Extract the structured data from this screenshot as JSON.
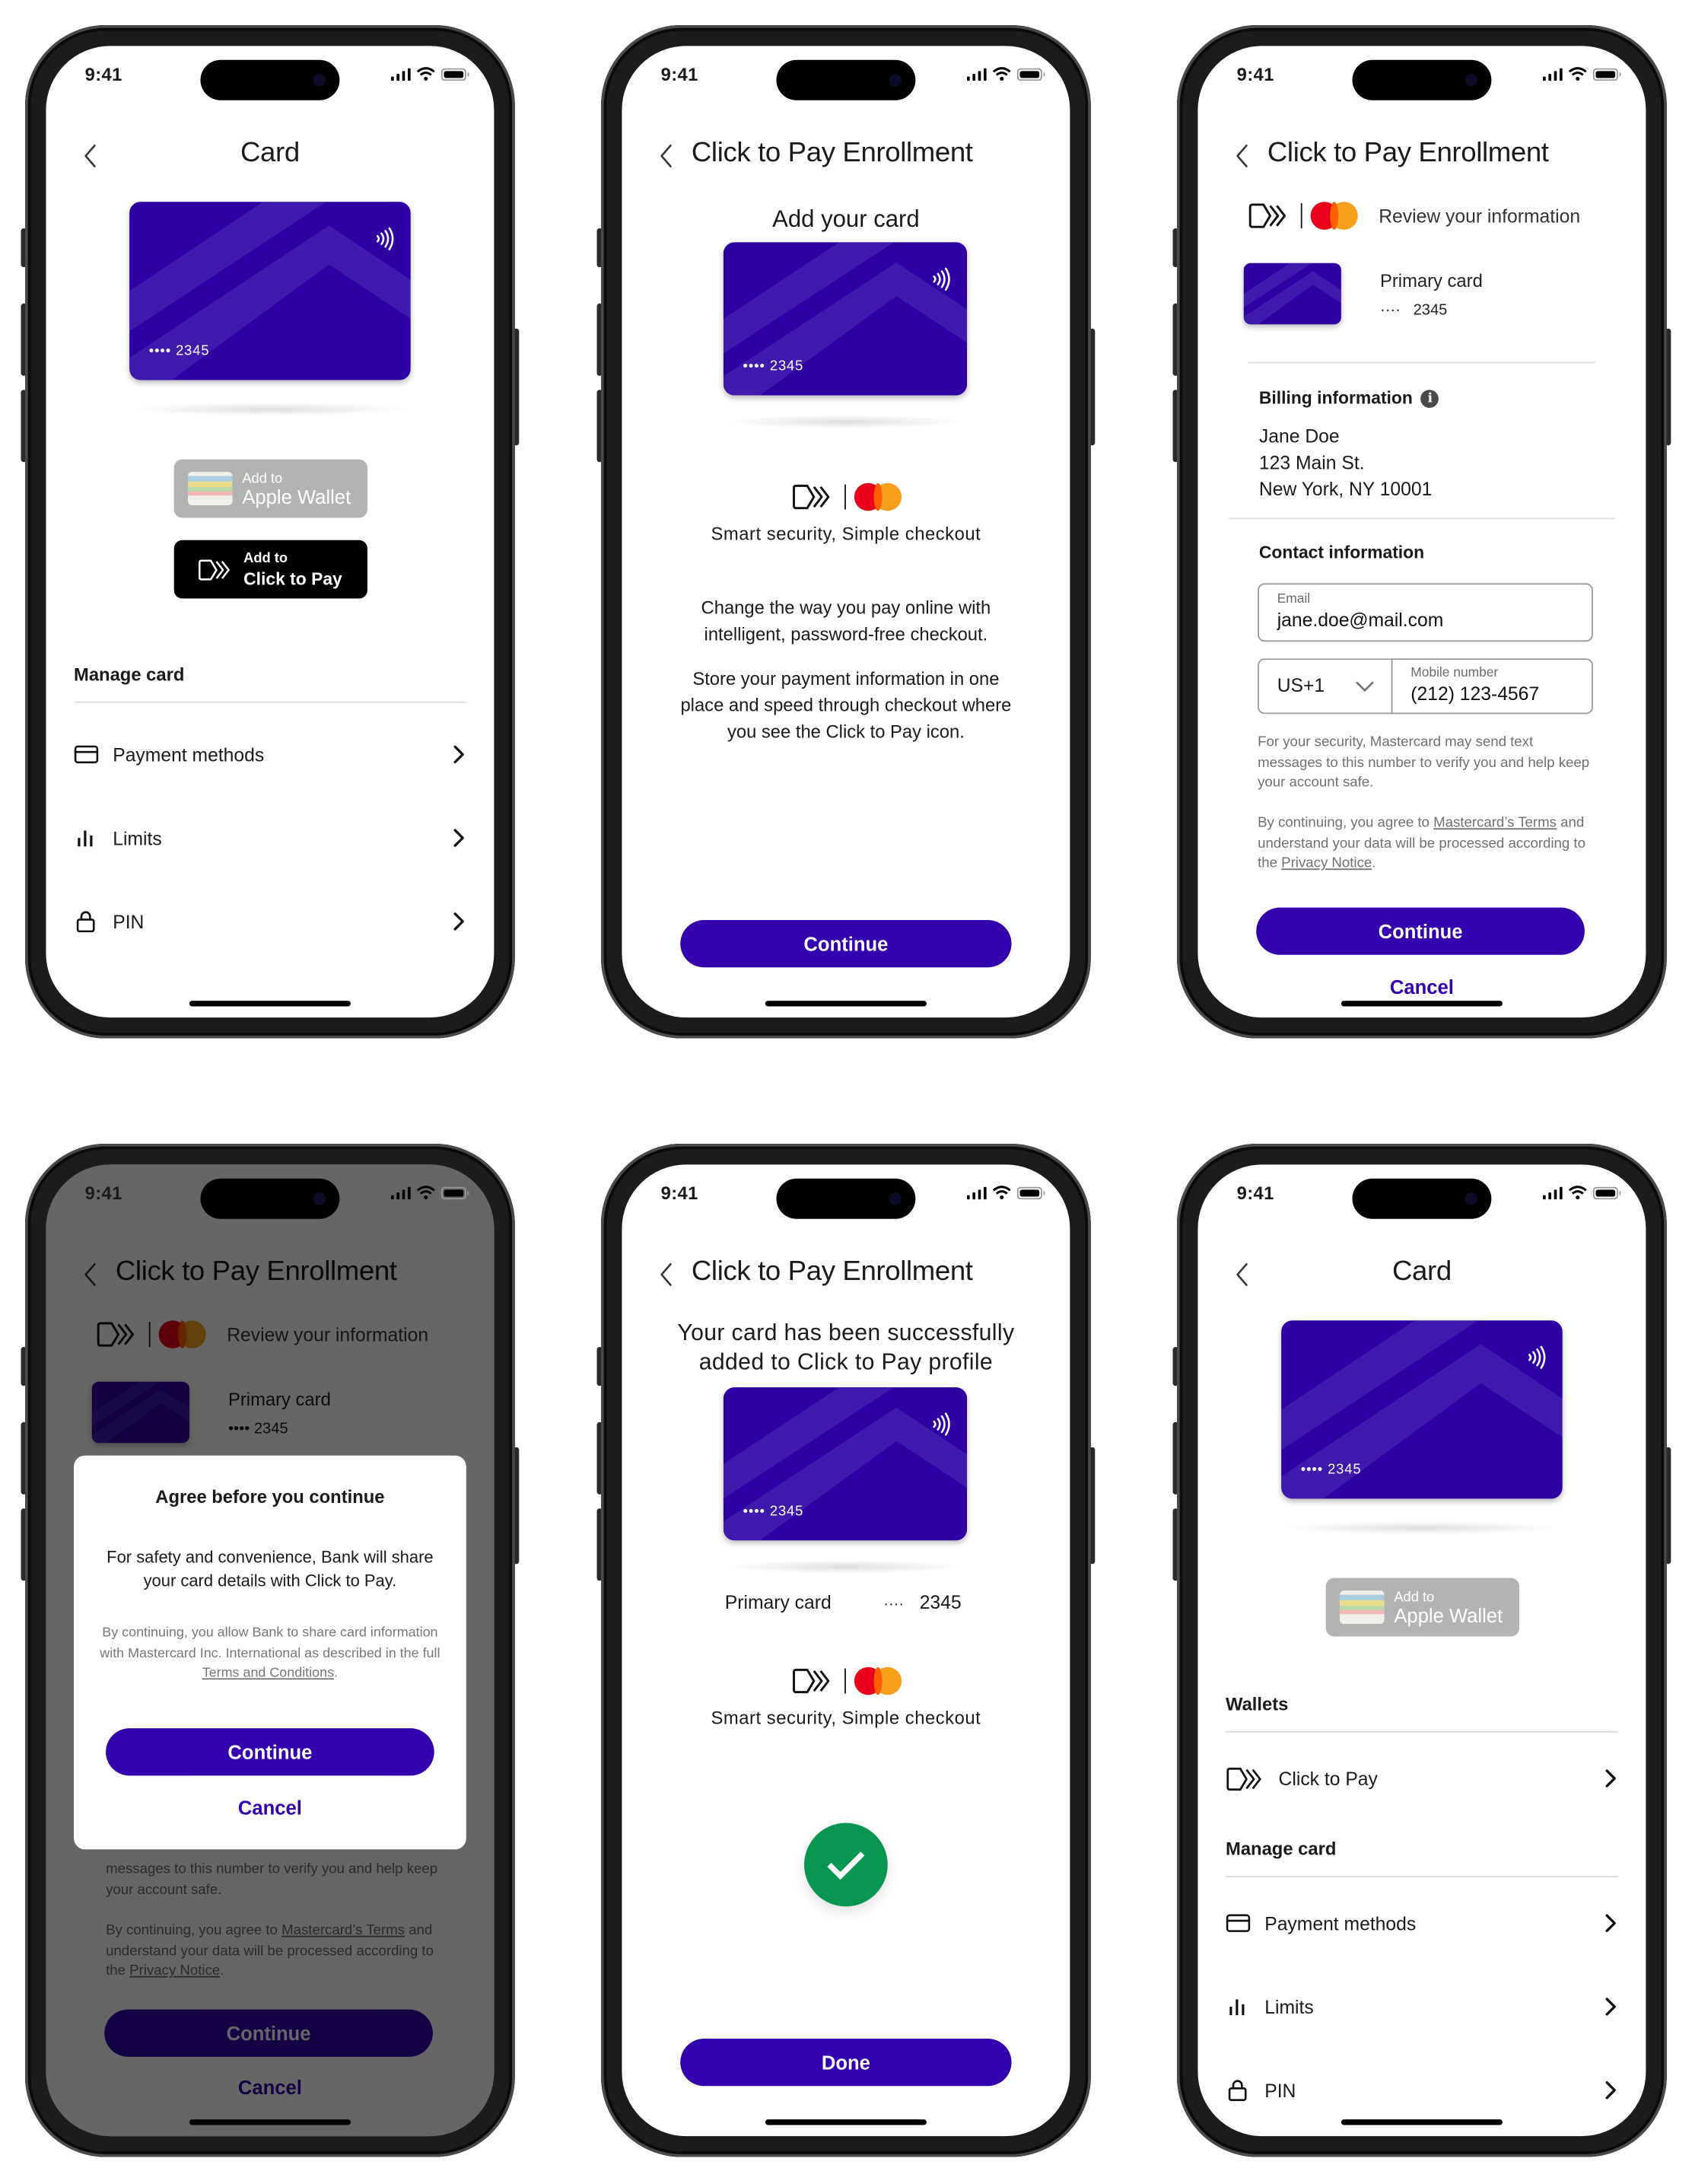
{
  "status_bar": {
    "time": "9:41"
  },
  "brand": {
    "accent": "#3300ad",
    "card_base": "#2e00a3",
    "card_stripe": "#3f1aad",
    "success_green": "#079650",
    "mc_red": "#eb001b",
    "mc_orange": "#f79e1b"
  },
  "card": {
    "masked_dots": "••••",
    "last4": "2345",
    "dots_plain": "····"
  },
  "screen1": {
    "title": "Card",
    "wallet_button": {
      "line1": "Add to",
      "line2": "Apple Wallet"
    },
    "ctp_button": {
      "line1": "Add to",
      "line2": "Click to Pay"
    },
    "manage_header": "Manage card",
    "items": [
      {
        "icon": "credit-card-icon",
        "label": "Payment methods"
      },
      {
        "icon": "bar-chart-icon",
        "label": "Limits"
      },
      {
        "icon": "lock-icon",
        "label": "PIN"
      }
    ]
  },
  "screen2": {
    "title": "Click to Pay Enrollment",
    "subtitle": "Add your card",
    "tagline": "Smart security, Simple checkout",
    "para1": "Change the way you pay online with intelligent, password-free checkout.",
    "para2": "Store your payment information in one place and speed through checkout where you see the Click to Pay icon.",
    "continue": "Continue"
  },
  "screen3": {
    "title": "Click to Pay Enrollment",
    "review": "Review your information",
    "card_label": "Primary card",
    "billing_header": "Billing information",
    "billing_lines": [
      "Jane Doe",
      "123 Main St.",
      "New York, NY 10001"
    ],
    "contact_header": "Contact information",
    "email_label": "Email",
    "email_value": "jane.doe@mail.com",
    "country_code": "US+1",
    "mobile_label": "Mobile number",
    "mobile_value": "(212) 123-4567",
    "security_note": "For your security, Mastercard may send text messages to this number to verify you and help keep your account safe.",
    "terms_prefix": "By continuing, you agree to ",
    "terms_link": "Mastercard’s Terms",
    "terms_mid": " and understand your data will be processed according to the ",
    "privacy_link": "Privacy Notice",
    "terms_suffix": ".",
    "continue": "Continue",
    "cancel": "Cancel"
  },
  "screen4": {
    "modal_title": "Agree before you continue",
    "modal_body": "For safety and convenience, Bank will share your card details with Click to Pay.",
    "modal_fine_prefix": "By continuing, you allow Bank to share card information with Mastercard Inc. International as described in the full ",
    "modal_fine_link": "Terms and Conditions",
    "modal_fine_suffix": ".",
    "continue": "Continue",
    "cancel": "Cancel",
    "bg_security_tail": "messages to this number to verify you and help keep your account safe."
  },
  "screen5": {
    "title": "Click to Pay Enrollment",
    "headline": "Your card has been successfully added to Click to Pay profile",
    "card_label": "Primary card",
    "tagline": "Smart security, Simple checkout",
    "done": "Done"
  },
  "screen6": {
    "title": "Card",
    "wallet_button": {
      "line1": "Add to",
      "line2": "Apple Wallet"
    },
    "wallets_header": "Wallets",
    "ctp_item": "Click to Pay",
    "manage_header": "Manage card",
    "items": [
      {
        "icon": "credit-card-icon",
        "label": "Payment methods"
      },
      {
        "icon": "bar-chart-icon",
        "label": "Limits"
      },
      {
        "icon": "lock-icon",
        "label": "PIN"
      }
    ]
  }
}
